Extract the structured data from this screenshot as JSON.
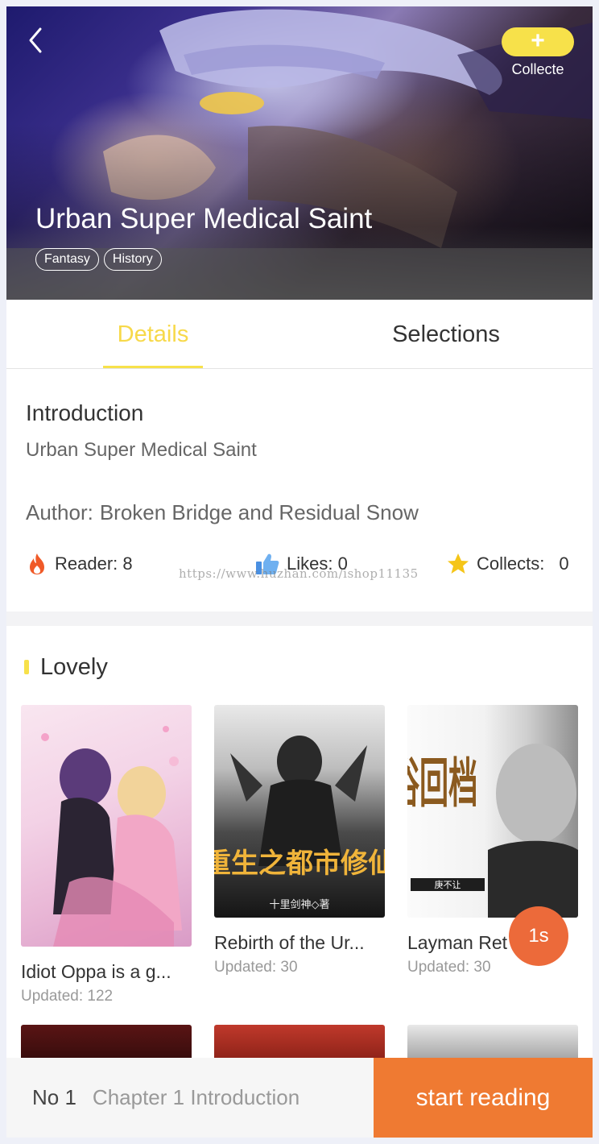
{
  "hero": {
    "title": "Urban Super Medical Saint",
    "tags": [
      "Fantasy",
      "History"
    ],
    "collect": {
      "icon_text": "+",
      "label": "Collecte"
    }
  },
  "tabs": [
    {
      "label": "Details",
      "active": true
    },
    {
      "label": "Selections",
      "active": false
    }
  ],
  "intro": {
    "heading": "Introduction",
    "text": "Urban Super Medical Saint",
    "author_label": "Author:",
    "author_name": "Broken Bridge and Residual Snow"
  },
  "stats": {
    "reader": "Reader: 8",
    "likes": "Likes: 0",
    "collects_label": "Collects:",
    "collects_value": "0"
  },
  "watermark": "https://www.huzhan.com/ishop11135",
  "lovely": {
    "title": "Lovely",
    "books": [
      {
        "title": "Idiot Oppa is a g...",
        "updated": "Updated:  122"
      },
      {
        "title": "Rebirth of the Ur...",
        "updated": "Updated:  30",
        "cover_text": "重生之都市修仙",
        "cover_author": "十里剑神◇著"
      },
      {
        "title": "Layman Ret",
        "updated": "Updated:  30",
        "cover_text": "俗回档",
        "cover_author": "庚不让"
      }
    ]
  },
  "timer": "1s",
  "bottom": {
    "chapter_no": "No 1",
    "chapter_title": "Chapter 1 Introduction",
    "start_label": "start reading"
  },
  "colors": {
    "accent_yellow": "#f7e14a",
    "start_orange": "#ef7a32",
    "timer_orange": "#ec6a3a"
  }
}
